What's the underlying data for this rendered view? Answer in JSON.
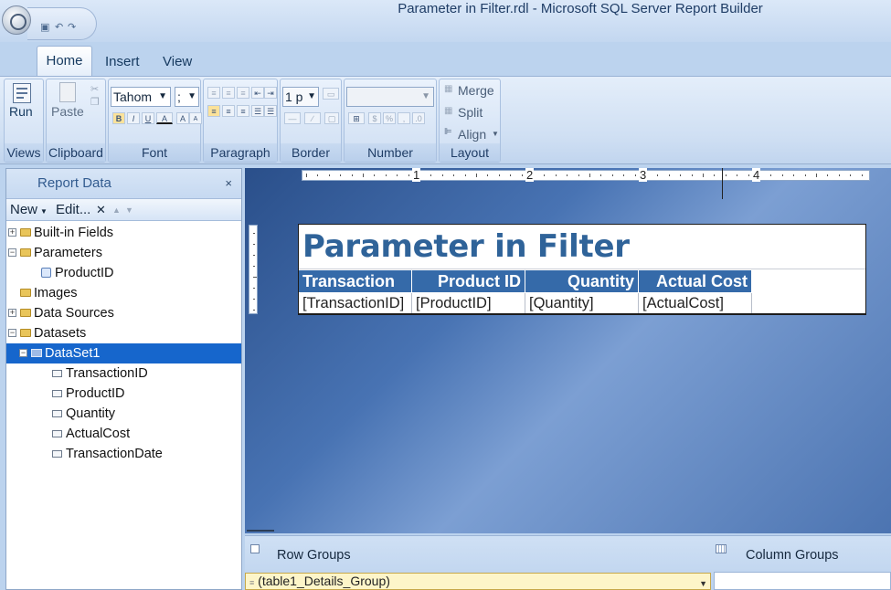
{
  "window": {
    "title": "Parameter in Filter.rdl - Microsoft SQL Server Report Builder"
  },
  "ribbon": {
    "tabs": [
      {
        "label": "Home",
        "active": true
      },
      {
        "label": "Insert",
        "active": false
      },
      {
        "label": "View",
        "active": false
      }
    ],
    "groups": {
      "views": {
        "label": "Views",
        "run_label": "Run"
      },
      "clipboard": {
        "label": "Clipboard",
        "paste_label": "Paste"
      },
      "font": {
        "label": "Font",
        "font_name": "Tahom",
        "font_size": ";"
      },
      "paragraph": {
        "label": "Paragraph"
      },
      "border": {
        "label": "Border",
        "width_value": "1 p"
      },
      "number": {
        "label": "Number"
      },
      "layout": {
        "label": "Layout",
        "merge_label": "Merge",
        "split_label": "Split",
        "align_label": "Align"
      }
    }
  },
  "report_data": {
    "title": "Report Data",
    "close_glyph": "×",
    "toolbar": {
      "new_label": "New",
      "edit_label": "Edit...",
      "delete_glyph": "✕"
    },
    "tree": [
      {
        "label": "Built-in Fields",
        "expander": "+",
        "icon": "folder-icon"
      },
      {
        "label": "Parameters",
        "expander": "−",
        "icon": "folder-icon"
      },
      {
        "label": "ProductID",
        "expander": "",
        "icon": "parameter-icon"
      },
      {
        "label": "Images",
        "expander": "",
        "icon": "folder-icon"
      },
      {
        "label": "Data Sources",
        "expander": "+",
        "icon": "folder-icon"
      },
      {
        "label": "Datasets",
        "expander": "−",
        "icon": "folder-icon"
      },
      {
        "label": "DataSet1",
        "expander": "−",
        "icon": "dataset-icon",
        "selected": true
      },
      {
        "label": "TransactionID",
        "expander": "",
        "icon": "field-icon"
      },
      {
        "label": "ProductID",
        "expander": "",
        "icon": "field-icon"
      },
      {
        "label": "Quantity",
        "expander": "",
        "icon": "field-icon"
      },
      {
        "label": "ActualCost",
        "expander": "",
        "icon": "field-icon"
      },
      {
        "label": "TransactionDate",
        "expander": "",
        "icon": "field-icon"
      }
    ]
  },
  "ruler": {
    "marks": [
      "1",
      "2",
      "3",
      "4"
    ]
  },
  "report": {
    "title": "Parameter in Filter",
    "table": {
      "headers": [
        "Transaction",
        "Product ID",
        "Quantity",
        "Actual Cost"
      ],
      "cells": [
        "[TransactionID]",
        "[ProductID]",
        "[Quantity]",
        "[ActualCost]"
      ]
    }
  },
  "groups": {
    "row_groups_label": "Row Groups",
    "column_groups_label": "Column Groups",
    "row_group_item": "(table1_Details_Group)",
    "row_group_item_prefix": "≡"
  },
  "colors": {
    "accent": "#356aa9",
    "selection": "#1666cc",
    "title_text": "#2f6399"
  }
}
